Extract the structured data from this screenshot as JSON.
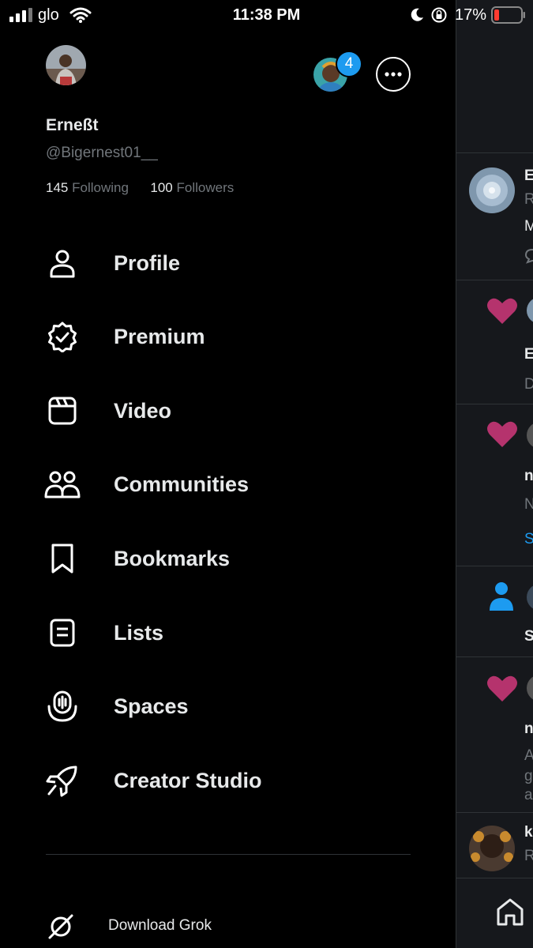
{
  "status_bar": {
    "carrier": "glo",
    "time": "11:38 PM",
    "battery_percent": "17%"
  },
  "account": {
    "display_name": "Erneßt",
    "handle": "@Bigernest01__",
    "following_count": "145",
    "following_label": "Following",
    "followers_count": "100",
    "followers_label": "Followers",
    "other_accounts_badge": "4"
  },
  "menu": [
    {
      "label": "Profile",
      "icon": "person-icon"
    },
    {
      "label": "Premium",
      "icon": "verified-badge-icon"
    },
    {
      "label": "Video",
      "icon": "video-clapper-icon"
    },
    {
      "label": "Communities",
      "icon": "communities-icon"
    },
    {
      "label": "Bookmarks",
      "icon": "bookmark-icon"
    },
    {
      "label": "Lists",
      "icon": "list-icon"
    },
    {
      "label": "Spaces",
      "icon": "spaces-mic-icon"
    },
    {
      "label": "Creator Studio",
      "icon": "rocket-icon"
    }
  ],
  "footer": {
    "grok_label": "Download Grok"
  },
  "feed_peek": {
    "row1": {
      "l1": "E",
      "l2": "R",
      "l3": "M"
    },
    "row2": {
      "l1": "E",
      "l2": "D"
    },
    "row3": {
      "l1": "n",
      "l2": "N",
      "l3": "S"
    },
    "row4": {
      "l1": "S"
    },
    "row5": {
      "l1": "n",
      "l2": "A",
      "l3": "g",
      "l4": "a"
    },
    "row6": {
      "l1": "k",
      "l2": "R"
    }
  },
  "colors": {
    "background": "#000000",
    "text_primary": "#e7e9ea",
    "text_secondary": "#71767b",
    "accent_blue": "#1d9bf0",
    "like_pink": "#b5336d",
    "divider": "#2f3336"
  }
}
